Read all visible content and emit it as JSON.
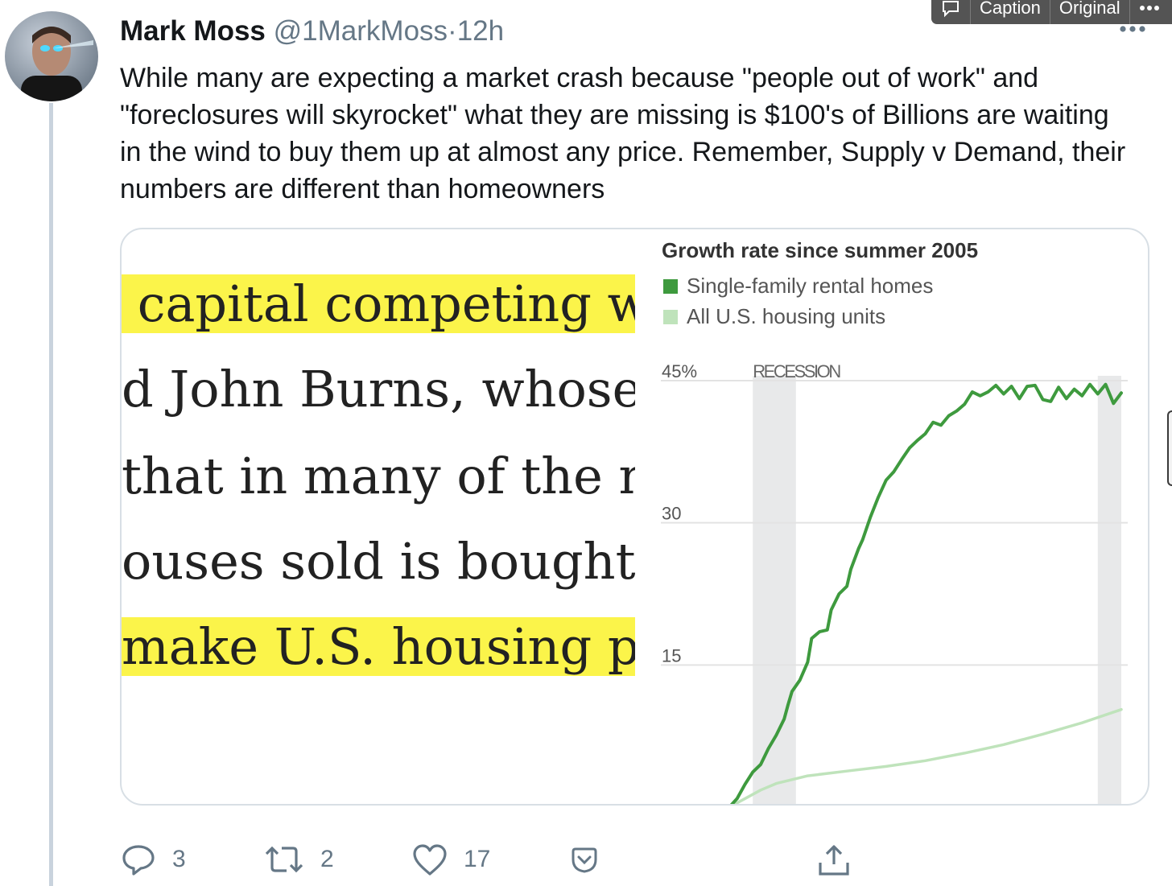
{
  "tweet": {
    "author_name": "Mark Moss",
    "handle": "@1MarkMoss",
    "separator": "·",
    "time": "12h",
    "text": "While many are expecting a market crash because \"people out of work\" and \"foreclosures will skyrocket\" what they are missing is $100's of Billions are waiting in the wind to buy them up at almost any price. Remember, Supply v Demand, their numbers are different than homeowners",
    "more_icon": "more-horizontal-icon"
  },
  "overlay_toolbar": {
    "icon": "speech-bubble-icon",
    "caption_label": "Caption",
    "original_label": "Original",
    "more_icon": "more-horizontal-icon"
  },
  "article_clip": {
    "lines": [
      {
        "text": "capital competing w",
        "highlighted": true
      },
      {
        "text": "d John Burns, whose",
        "highlighted": false
      },
      {
        "text": "that in many of the n",
        "highlighted": false
      },
      {
        "text": "ouses sold is bought",
        "highlighted": false
      },
      {
        "text": "make U.S. housing pe",
        "highlighted": true
      }
    ],
    "highlight_color": "#fbf44a"
  },
  "chart_data": {
    "type": "line",
    "title": "Growth rate since summer 2005",
    "xlabel": "",
    "ylabel": "",
    "ylim": [
      0,
      45
    ],
    "y_ticks": [
      "45%",
      "30",
      "15"
    ],
    "y_tick_values": [
      45,
      30,
      15
    ],
    "grid": true,
    "legend_position": "top-left",
    "recession_label": "RECESSION",
    "recessions": [
      [
        0.06,
        0.17
      ],
      [
        0.94,
        1.0
      ]
    ],
    "series": [
      {
        "name": "Single-family rental homes",
        "color": "#3e9a3e",
        "x": [
          0.0,
          0.02,
          0.04,
          0.06,
          0.08,
          0.1,
          0.12,
          0.14,
          0.15,
          0.16,
          0.18,
          0.2,
          0.21,
          0.23,
          0.25,
          0.26,
          0.28,
          0.3,
          0.31,
          0.33,
          0.34,
          0.36,
          0.38,
          0.4,
          0.42,
          0.44,
          0.46,
          0.48,
          0.5,
          0.52,
          0.54,
          0.56,
          0.58,
          0.6,
          0.62,
          0.64,
          0.66,
          0.68,
          0.7,
          0.72,
          0.74,
          0.76,
          0.78,
          0.8,
          0.82,
          0.84,
          0.86,
          0.88,
          0.9,
          0.92,
          0.94,
          0.96,
          0.98,
          1.0
        ],
        "values": [
          0.0,
          0.9,
          2.4,
          3.7,
          4.5,
          6.2,
          7.6,
          9.3,
          10.8,
          12.2,
          13.4,
          15.3,
          17.8,
          18.5,
          18.7,
          20.8,
          22.5,
          23.3,
          25.1,
          27.3,
          28.2,
          30.6,
          32.7,
          34.5,
          35.4,
          36.7,
          37.9,
          38.7,
          39.4,
          40.6,
          40.3,
          41.3,
          41.8,
          42.5,
          43.8,
          43.4,
          43.8,
          44.5,
          43.6,
          44.4,
          43.1,
          44.4,
          44.5,
          43.0,
          42.8,
          44.3,
          43.1,
          44.1,
          43.4,
          44.6,
          43.6,
          44.6,
          42.6,
          43.7
        ]
      },
      {
        "name": "All U.S. housing units",
        "color": "#bfe3bb",
        "x": [
          0.0,
          0.04,
          0.08,
          0.12,
          0.16,
          0.2,
          0.3,
          0.4,
          0.5,
          0.6,
          0.7,
          0.8,
          0.9,
          1.0
        ],
        "values": [
          0.0,
          0.9,
          1.8,
          2.5,
          2.9,
          3.3,
          3.8,
          4.3,
          4.9,
          5.7,
          6.6,
          7.7,
          8.9,
          10.3
        ]
      }
    ]
  },
  "actions": {
    "reply_icon": "reply-icon",
    "reply_count": "3",
    "retweet_icon": "retweet-icon",
    "retweet_count": "2",
    "like_icon": "heart-icon",
    "like_count": "17",
    "save_icon": "pocket-icon",
    "share_icon": "share-icon"
  }
}
